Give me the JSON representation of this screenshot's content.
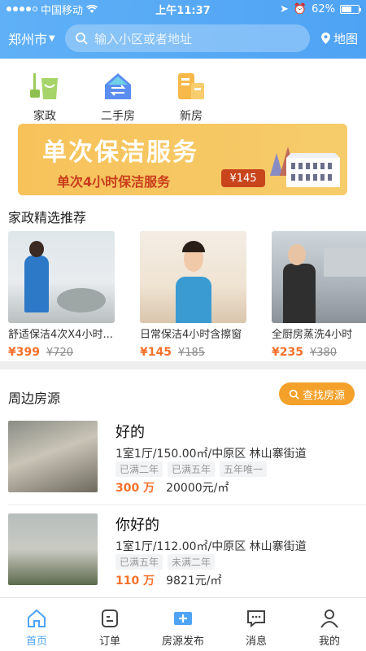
{
  "status": {
    "carrier": "中国移动",
    "time": "上午11:37",
    "battery": "62%",
    "battery_level": 0.62
  },
  "nav": {
    "city": "郑州市",
    "search_placeholder": "输入小区或者地址",
    "map_label": "地图"
  },
  "quick": [
    {
      "label": "家政",
      "icon": "mop-bucket-icon"
    },
    {
      "label": "二手房",
      "icon": "house-transfer-icon"
    },
    {
      "label": "新房",
      "icon": "new-house-icon"
    }
  ],
  "banner": {
    "title": "单次保洁服务",
    "subtitle": "单次4小时保洁服务",
    "price": "¥145"
  },
  "recommend": {
    "title": "家政精选推荐",
    "items": [
      {
        "name": "舒适保洁4次X4小时...",
        "price": "¥399",
        "old_price": "¥720"
      },
      {
        "name": "日常保洁4小时含擦窗",
        "price": "¥145",
        "old_price": "¥185"
      },
      {
        "name": "全厨房蒸洗4小时",
        "price": "¥235",
        "old_price": "¥380"
      }
    ]
  },
  "nearby": {
    "title": "周边房源",
    "find_button": "查找房源",
    "houses": [
      {
        "title": "好的",
        "info": "1室1厅/150.00㎡/中原区 林山寨街道",
        "tags": [
          "已满二年",
          "已满五年",
          "五年唯一"
        ],
        "total": "300 万",
        "unit_price": "20000元/㎡"
      },
      {
        "title": "你好的",
        "info": "1室1厅/112.00㎡/中原区 林山寨街道",
        "tags": [
          "已满五年",
          "未满二年"
        ],
        "total": "110 万",
        "unit_price": "9821元/㎡"
      }
    ]
  },
  "tabs": [
    {
      "label": "首页",
      "icon": "home-icon",
      "active": true
    },
    {
      "label": "订单",
      "icon": "order-icon",
      "active": false
    },
    {
      "label": "房源发布",
      "icon": "publish-plus-icon",
      "active": false
    },
    {
      "label": "消息",
      "icon": "message-icon",
      "active": false
    },
    {
      "label": "我的",
      "icon": "profile-icon",
      "active": false
    }
  ],
  "colors": {
    "primary": "#4fa3f4",
    "accent_orange": "#f4712b",
    "find_button": "#f4a12b",
    "banner": "#f7c25a"
  }
}
